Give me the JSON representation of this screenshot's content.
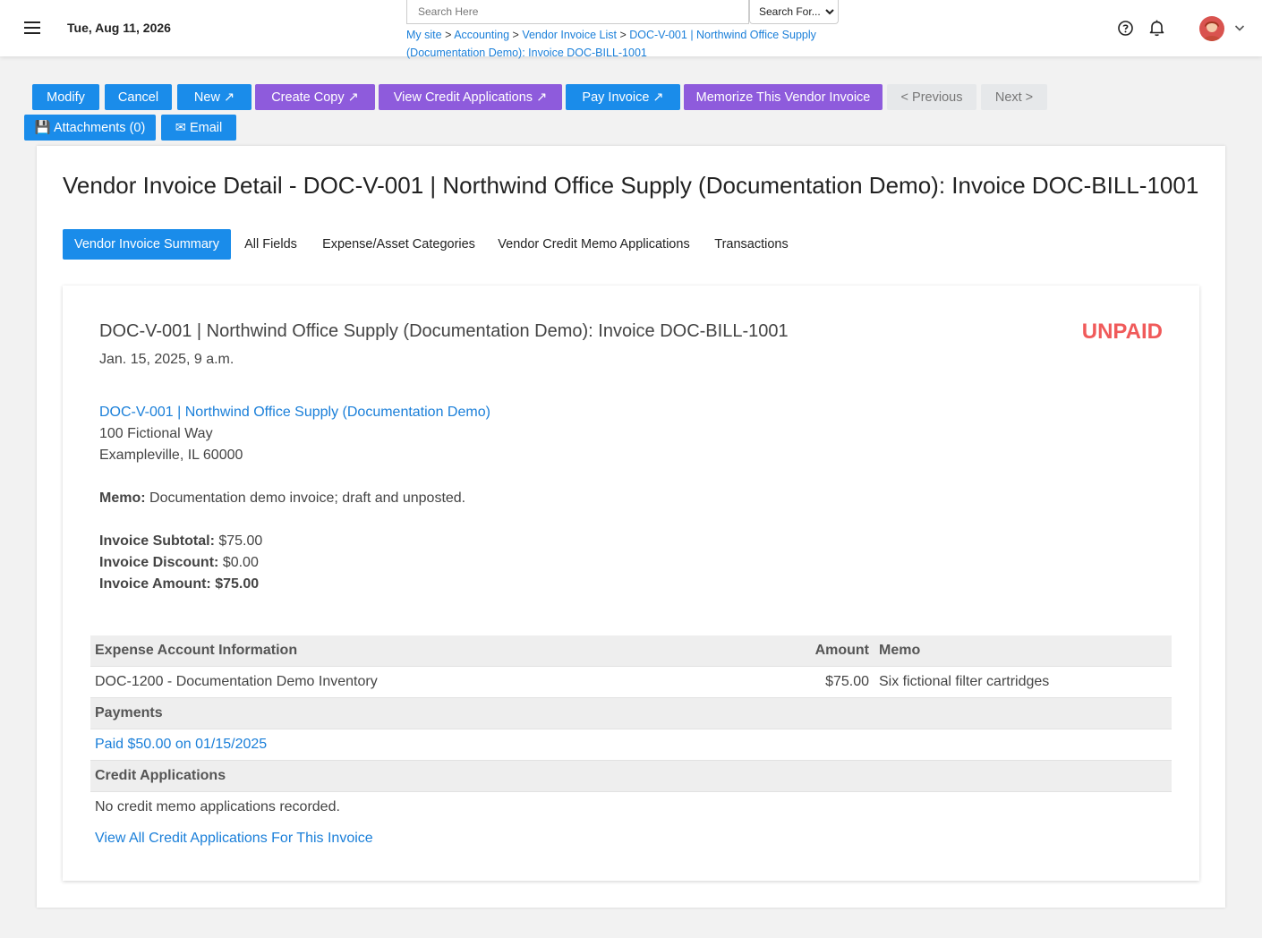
{
  "header": {
    "date": "Tue, Aug 11, 2026",
    "search_placeholder": "Search Here",
    "search_for": "Search For...",
    "breadcrumb": {
      "items": [
        "My site",
        "Accounting",
        "Vendor Invoice List",
        "DOC-V-001 | Northwind Office Supply (Documentation Demo): Invoice DOC-BILL-1001"
      ],
      "separator": ">"
    },
    "icons": [
      "menu-icon",
      "help-icon",
      "bell-icon",
      "chevron-down-icon"
    ]
  },
  "actions": {
    "modify": "Modify",
    "cancel": "Cancel",
    "new": "New ↗",
    "create_copy": "Create Copy ↗",
    "view_credit_applications": "View Credit Applications ↗",
    "pay_invoice": "Pay Invoice ↗",
    "memorize": "Memorize This Vendor Invoice",
    "previous": "< Previous",
    "next": "Next >",
    "attachments": "💾 Attachments (0)",
    "email": "✉ Email"
  },
  "page": {
    "title": "Vendor Invoice Detail - DOC-V-001 | Northwind Office Supply (Documentation Demo): Invoice DOC-BILL-1001",
    "tabs": [
      "Vendor Invoice Summary",
      "All Fields",
      "Expense/Asset Categories",
      "Vendor Credit Memo Applications",
      "Transactions"
    ],
    "active_tab": "Vendor Invoice Summary"
  },
  "invoice": {
    "heading": "DOC-V-001 | Northwind Office Supply (Documentation Demo): Invoice DOC-BILL-1001",
    "status": "UNPAID",
    "date": "Jan. 15, 2025, 9 a.m.",
    "vendor_link": "DOC-V-001 | Northwind Office Supply (Documentation Demo)",
    "address_line1": "100 Fictional Way",
    "address_line2": "Exampleville, IL 60000",
    "memo_label": "Memo:",
    "memo_value": "Documentation demo invoice; draft and unposted.",
    "subtotal_label": "Invoice Subtotal:",
    "subtotal_value": "$75.00",
    "discount_label": "Invoice Discount:",
    "discount_value": "$0.00",
    "amount_label": "Invoice Amount:",
    "amount_value": "$75.00"
  },
  "table": {
    "headers": [
      "Expense Account Information",
      "Amount",
      "Memo"
    ],
    "rows": [
      {
        "account": "DOC-1200 - Documentation Demo Inventory",
        "amount": "$75.00",
        "memo": "Six fictional filter cartridges"
      }
    ],
    "payments_header": "Payments",
    "payment_link": "Paid $50.00 on 01/15/2025",
    "credit_header": "Credit Applications",
    "credit_empty": "No credit memo applications recorded.",
    "credit_link": "View All Credit Applications For This Invoice"
  },
  "colors": {
    "primary": "#1a8cea",
    "purple": "#8e5bdc",
    "status_unpaid": "#f05a5a",
    "link": "#1a7fd9"
  }
}
